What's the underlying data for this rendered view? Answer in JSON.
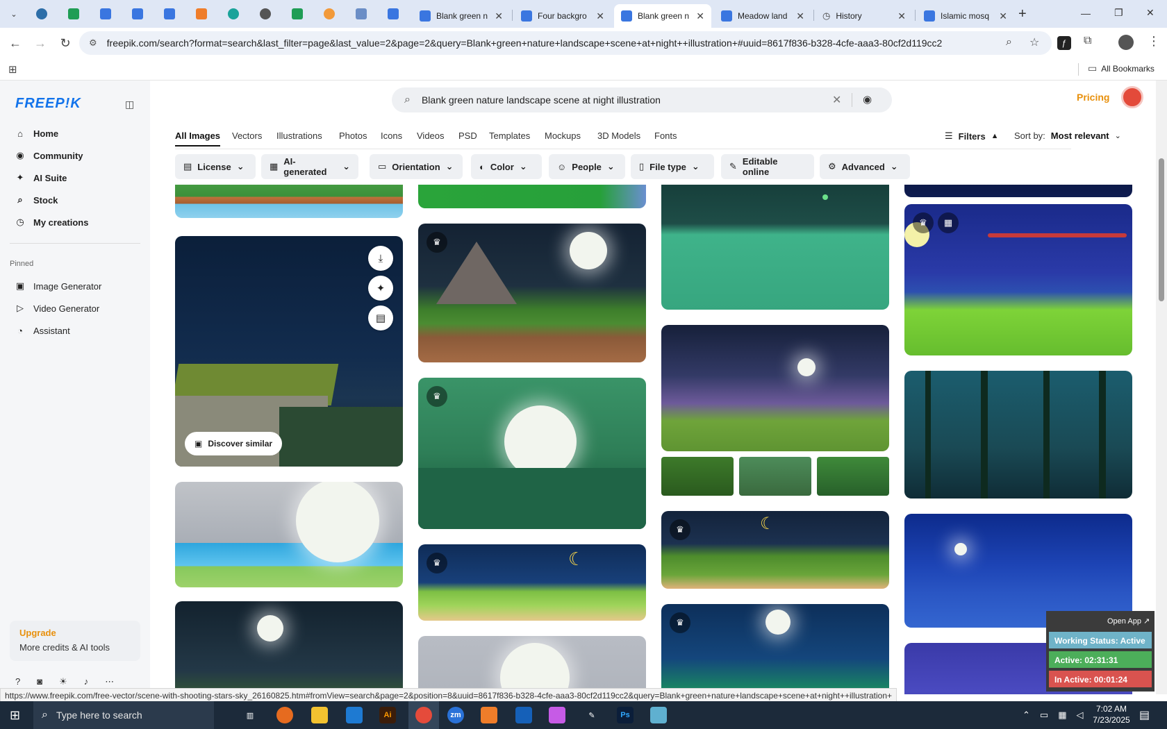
{
  "browser": {
    "tabs": [
      {
        "title": "Blank green n",
        "close": "✕"
      },
      {
        "title": "Four backgro",
        "close": "✕"
      },
      {
        "title": "Blank green n",
        "close": "✕"
      },
      {
        "title": "Meadow land",
        "close": "✕"
      },
      {
        "title": "History",
        "close": "✕"
      },
      {
        "title": "Islamic mosq",
        "close": "✕"
      }
    ],
    "new_tab": "+",
    "url": "freepik.com/search?format=search&last_filter=page&last_value=2&page=2&query=Blank+green+nature+landscape+scene+at+night++illustration+#uuid=8617f836-b328-4cfe-aaa3-80cf2d119cc2",
    "all_bookmarks": "All Bookmarks",
    "window_controls": {
      "minimize": "—",
      "restore": "❐",
      "close": "✕"
    }
  },
  "sidebar": {
    "logo": "FREEP!K",
    "nav": [
      {
        "label": "Home",
        "icon": "⌂"
      },
      {
        "label": "Community",
        "icon": "◉"
      },
      {
        "label": "AI Suite",
        "icon": "✦"
      },
      {
        "label": "Stock",
        "icon": "⌕"
      },
      {
        "label": "My creations",
        "icon": "◷"
      }
    ],
    "pinned_heading": "Pinned",
    "pinned": [
      {
        "label": "Image Generator",
        "icon": "▣"
      },
      {
        "label": "Video Generator",
        "icon": "▷"
      },
      {
        "label": "Assistant",
        "icon": "◔"
      }
    ],
    "upgrade": {
      "title": "Upgrade",
      "subtitle": "More credits & AI tools"
    }
  },
  "search": {
    "query": "Blank green nature landscape scene at night  illustration"
  },
  "header": {
    "pricing": "Pricing"
  },
  "type_tabs": [
    "All Images",
    "Vectors",
    "Illustrations",
    "Photos",
    "Icons",
    "Videos",
    "PSD",
    "Templates",
    "Mockups",
    "3D Models",
    "Fonts"
  ],
  "filters_label": "Filters",
  "sort": {
    "label": "Sort by:",
    "value": "Most relevant"
  },
  "filters": [
    {
      "label": "License",
      "icon": "▤"
    },
    {
      "label": "AI-generated",
      "icon": "▦"
    },
    {
      "label": "Orientation",
      "icon": "▭"
    },
    {
      "label": "Color",
      "icon": "◐"
    },
    {
      "label": "People",
      "icon": "☺"
    },
    {
      "label": "File type",
      "icon": "▯"
    },
    {
      "label": "Editable online",
      "icon": "✎"
    },
    {
      "label": "Advanced",
      "icon": "⚙"
    }
  ],
  "hover_card": {
    "discover_similar": "Discover similar"
  },
  "status_url": "https://www.freepik.com/free-vector/scene-with-shooting-stars-sky_26160825.htm#fromView=search&page=2&position=8&uuid=8617f836-b328-4cfe-aaa3-80cf2d119cc2&query=Blank+green+nature+landscape+scene+at+night++illustration+",
  "tracker": {
    "open_app": "Open App ↗",
    "status": "Working Status: Active",
    "active": "Active: 02:31:31",
    "inactive": "In Active: 00:01:24"
  },
  "taskbar": {
    "search_placeholder": "Type here to search",
    "time": "7:02 AM",
    "date": "7/23/2025"
  },
  "colors": {
    "brand": "#1273eb",
    "pricing": "#e8900c",
    "upgrade": "#e8900c"
  }
}
